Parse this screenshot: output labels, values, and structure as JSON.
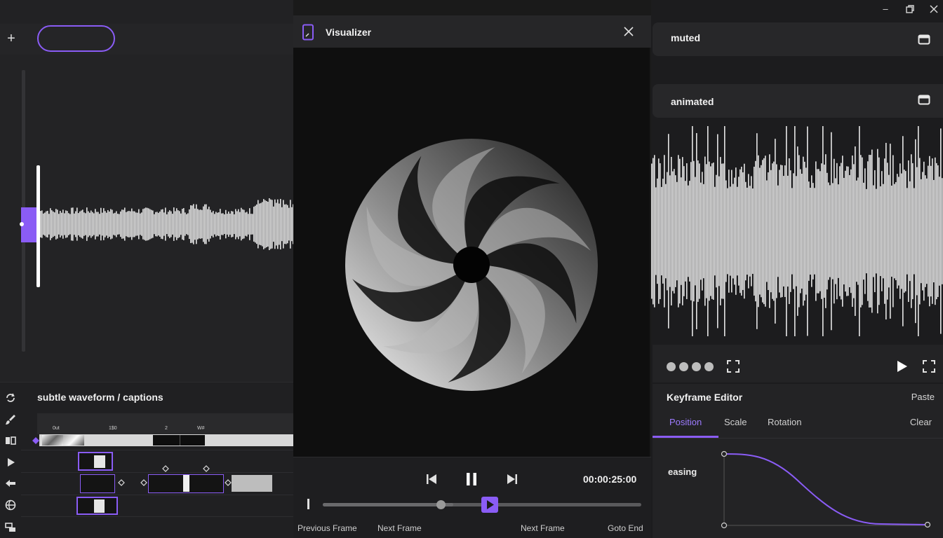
{
  "window": {
    "minimize_icon": "minimize-icon",
    "maximize_icon": "restore-icon",
    "close_icon": "close-icon"
  },
  "left_panel": {
    "add_icon": "plus-icon",
    "track_title": "subtle waveform / captions",
    "timeline_ruler_labels": [
      "0ut",
      "1$0",
      "2",
      "W#"
    ],
    "tool_icons": [
      "loop-icon",
      "brush-icon",
      "split-icon",
      "play-icon",
      "arrow-left-icon",
      "globe-icon",
      "layers-icon"
    ]
  },
  "visualizer": {
    "title": "Visualizer",
    "icon": "phone-icon",
    "close_icon": "close-icon",
    "time": "00:00:25:00",
    "progress": 0.41,
    "links": {
      "previous_frame": "Previous Frame",
      "next_frame_1": "Next Frame",
      "next_frame_2": "Next Frame",
      "goto_end": "Goto End"
    }
  },
  "right_panel": {
    "card1_label": "muted",
    "card2_label": "animated",
    "dots_count": 4,
    "keyframe_editor": {
      "title": "Keyframe Editor",
      "paste": "Paste",
      "tabs": [
        "Position",
        "Scale",
        "Rotation"
      ],
      "active_tab": "Position",
      "clear": "Clear",
      "curve_label": "easing"
    }
  },
  "colors": {
    "accent": "#8a5cf5",
    "panel": "#232325",
    "background": "#1c1c1e"
  }
}
